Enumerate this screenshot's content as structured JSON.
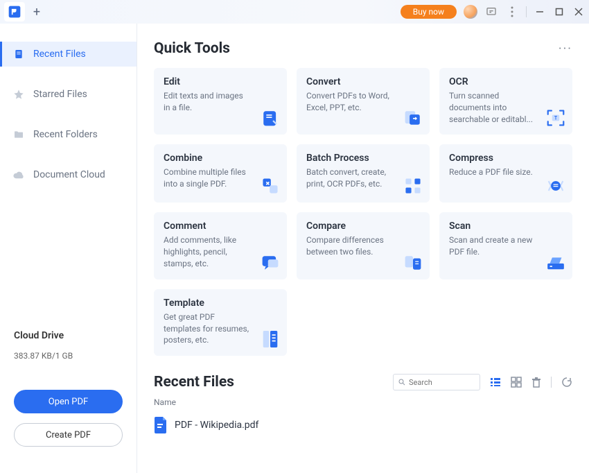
{
  "titlebar": {
    "buy_now": "Buy now"
  },
  "sidebar": {
    "items": [
      {
        "label": "Recent Files"
      },
      {
        "label": "Starred Files"
      },
      {
        "label": "Recent Folders"
      },
      {
        "label": "Document Cloud"
      }
    ],
    "cloud": {
      "title": "Cloud Drive",
      "usage": "383.87 KB/1 GB",
      "open_pdf": "Open PDF",
      "create_pdf": "Create PDF"
    }
  },
  "main": {
    "quick_tools_title": "Quick Tools",
    "tools": [
      {
        "title": "Edit",
        "desc": "Edit texts and images in a file."
      },
      {
        "title": "Convert",
        "desc": "Convert PDFs to Word, Excel, PPT, etc."
      },
      {
        "title": "OCR",
        "desc": "Turn scanned documents into searchable or editabl..."
      },
      {
        "title": "Combine",
        "desc": "Combine multiple files into a single PDF."
      },
      {
        "title": "Batch Process",
        "desc": "Batch convert, create, print, OCR PDFs, etc."
      },
      {
        "title": "Compress",
        "desc": "Reduce a PDF file size."
      },
      {
        "title": "Comment",
        "desc": "Add comments, like highlights, pencil, stamps, etc."
      },
      {
        "title": "Compare",
        "desc": "Compare differences between two files."
      },
      {
        "title": "Scan",
        "desc": "Scan and create a new PDF file."
      },
      {
        "title": "Template",
        "desc": "Get great PDF templates for resumes, posters, etc."
      }
    ],
    "recent_files_title": "Recent Files",
    "search_placeholder": "Search",
    "column_name": "Name",
    "files": [
      {
        "name": "PDF - Wikipedia.pdf"
      }
    ]
  }
}
